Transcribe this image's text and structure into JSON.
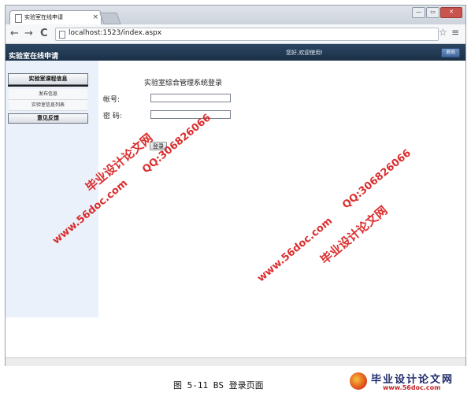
{
  "browser": {
    "tab_title": "实验室在线申请",
    "tab_close": "×",
    "window_min": "—",
    "window_max": "▭",
    "window_close": "✕",
    "back": "←",
    "forward": "→",
    "reload": "C",
    "url": "localhost:1523/index.aspx",
    "star": "☆",
    "menu": "≡"
  },
  "header": {
    "title": "实验室在线申请",
    "welcome": "您好,欢迎使用!",
    "logout": "退出"
  },
  "sidebar": {
    "section1": "实验室课程信息",
    "items": [
      "发布信息",
      "实验室信息列表"
    ],
    "section2": "意见反馈"
  },
  "login": {
    "title": "实验室综合管理系统登录",
    "username_label": "帐号:",
    "password_label": "密 码:",
    "username_value": "",
    "password_value": "",
    "submit": "登录"
  },
  "watermarks": {
    "site_name": "毕业设计论文网",
    "url": "www.56doc.com",
    "qq": "QQ:306826066"
  },
  "caption": "图 5-11 BS 登录页面",
  "logo": {
    "name": "毕业设计论文网",
    "url": "www.56doc.com"
  },
  "colors": {
    "banner": "#1f3650",
    "sidebar": "#eaf1fa",
    "watermark": "#d91c1c"
  }
}
